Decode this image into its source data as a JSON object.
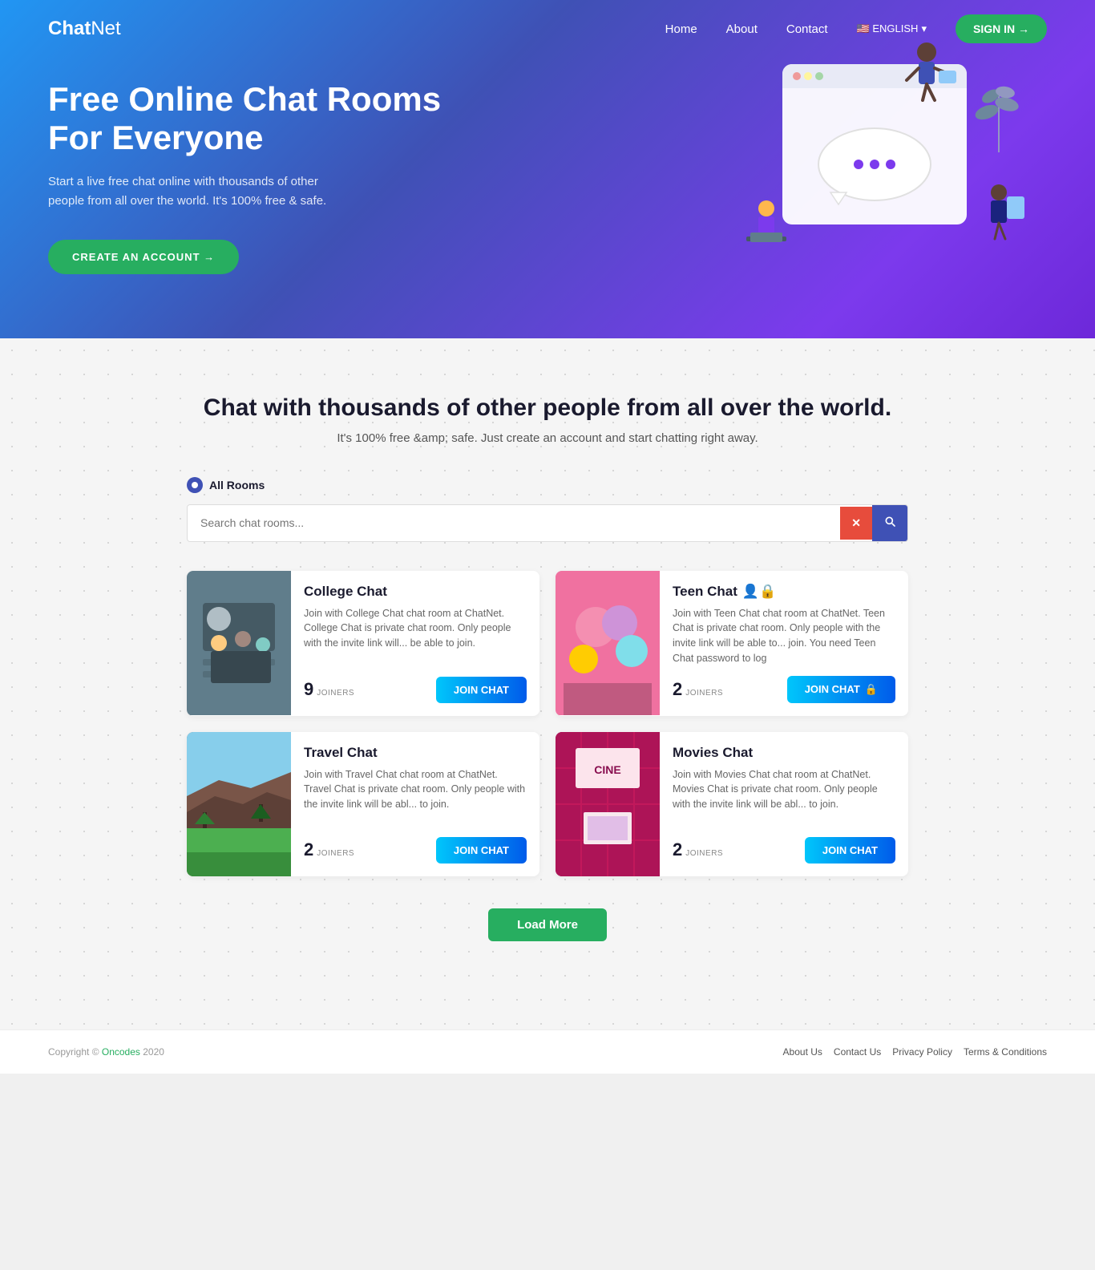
{
  "nav": {
    "logo_chat": "Chat",
    "logo_net": "Net",
    "links": [
      "Home",
      "About",
      "Contact"
    ],
    "lang": "🇺🇸 ENGLISH",
    "signin": "SIGN IN →"
  },
  "hero": {
    "title": "Free Online Chat Rooms For Everyone",
    "subtitle": "Start a live free chat online with thousands of other people from all over the world. It's 100% free & safe.",
    "cta": "CREATE AN ACCOUNT →"
  },
  "main_section": {
    "heading": "Chat with thousands of other people from all over the world.",
    "subtext": "It's 100% free &amp; safe. Just create an account and start chatting right away.",
    "all_rooms_label": "All Rooms",
    "search_placeholder": "Search chat rooms...",
    "clear_btn": "✕",
    "search_btn": "🔍"
  },
  "cards": [
    {
      "id": "college",
      "title": "College Chat",
      "description": "Join with College Chat chat room at ChatNet. College Chat is private chat room. Only people with the invite link will... be able to join.",
      "joiners": 9,
      "join_btn": "JOIN CHAT",
      "locked": false,
      "color1": "#607d8b",
      "color2": "#78909c"
    },
    {
      "id": "teen",
      "title": "Teen Chat",
      "description": "Join with Teen Chat chat room at ChatNet. Teen Chat is private chat room. Only people with the invite link will be able to... join. You need Teen Chat password to log",
      "joiners": 2,
      "join_btn": "JOIN CHAT",
      "locked": true,
      "color1": "#e91e63",
      "color2": "#f06292"
    },
    {
      "id": "travel",
      "title": "Travel Chat",
      "description": "Join with Travel Chat chat room at ChatNet. Travel Chat is private chat room. Only people with the invite link will be abl... to join.",
      "joiners": 2,
      "join_btn": "JOIN CHAT",
      "locked": false,
      "color1": "#795548",
      "color2": "#a1887f"
    },
    {
      "id": "movies",
      "title": "Movies Chat",
      "description": "Join with Movies Chat chat room at ChatNet. Movies Chat is private chat room. Only people with the invite link will be abl... to join.",
      "joiners": 2,
      "join_btn": "JOIN CHAT",
      "locked": false,
      "color1": "#880e4f",
      "color2": "#c2185b"
    }
  ],
  "load_more": "Load More",
  "footer": {
    "copy": "Copyright © Oncodes 2020",
    "links": [
      "About Us",
      "Contact Us",
      "Privacy Policy",
      "Terms & Conditions"
    ]
  }
}
